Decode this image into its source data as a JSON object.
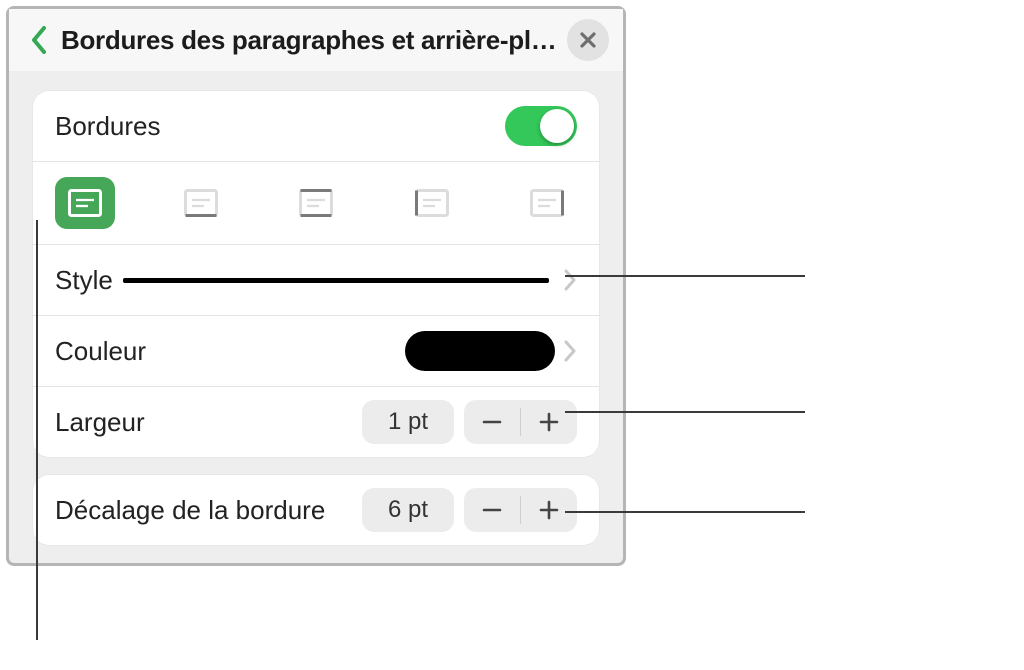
{
  "header": {
    "title": "Bordures des paragraphes et arrière-plans"
  },
  "borders": {
    "section_label": "Bordures",
    "enabled": true,
    "positions": [
      "box",
      "bottom",
      "top-bottom",
      "left",
      "right"
    ],
    "active_position": "box",
    "style_label": "Style",
    "color_label": "Couleur",
    "color_value": "#000000",
    "width_label": "Largeur",
    "width_value": "1 pt",
    "offset_label": "Décalage de la bordure",
    "offset_value": "6 pt"
  }
}
